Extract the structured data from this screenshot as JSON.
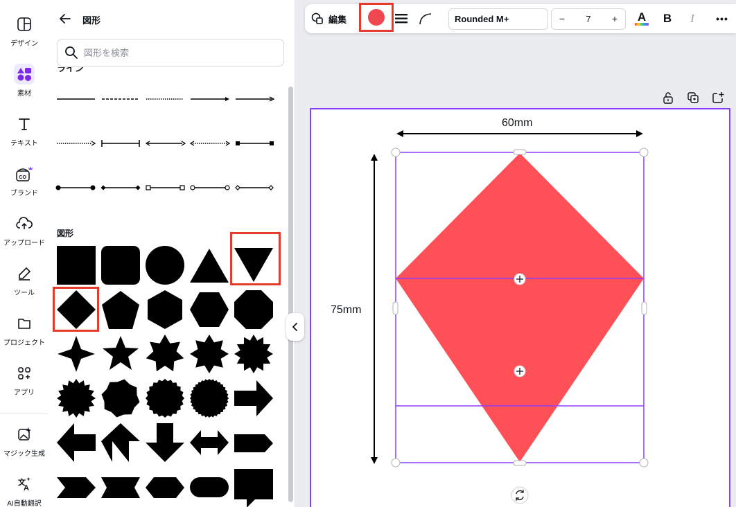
{
  "sidebar": {
    "items": [
      {
        "label": "デザイン",
        "icon": "layout-icon"
      },
      {
        "label": "素材",
        "icon": "elements-icon"
      },
      {
        "label": "テキスト",
        "icon": "text-icon"
      },
      {
        "label": "ブランド",
        "icon": "brand-icon"
      },
      {
        "label": "アップロード",
        "icon": "upload-icon"
      },
      {
        "label": "ツール",
        "icon": "tools-icon"
      },
      {
        "label": "プロジェクト",
        "icon": "folder-icon"
      },
      {
        "label": "アプリ",
        "icon": "apps-icon"
      },
      {
        "label": "マジック生成",
        "icon": "magic-media-icon"
      },
      {
        "label": "AI自動翻訳",
        "icon": "translate-icon"
      }
    ],
    "active_index": 1
  },
  "panel": {
    "title": "図形",
    "search_placeholder": "図形を検索",
    "cut_heading": "ライン",
    "shapes_heading": "図形"
  },
  "toolbar": {
    "edit_label": "編集",
    "fill_color": "#f0464f",
    "font_name": "Rounded M+",
    "font_size": "7",
    "minus": "−",
    "plus": "+",
    "bold": "B",
    "italic": "I",
    "more": "•••",
    "textcolor_letter": "A"
  },
  "canvas": {
    "width_label": "60mm",
    "height_label": "75mm",
    "shape_color": "#ff4f57",
    "selection_color": "#8b3dff"
  },
  "colors": {
    "accent": "#8b3dff",
    "highlight": "#e63a2e"
  }
}
